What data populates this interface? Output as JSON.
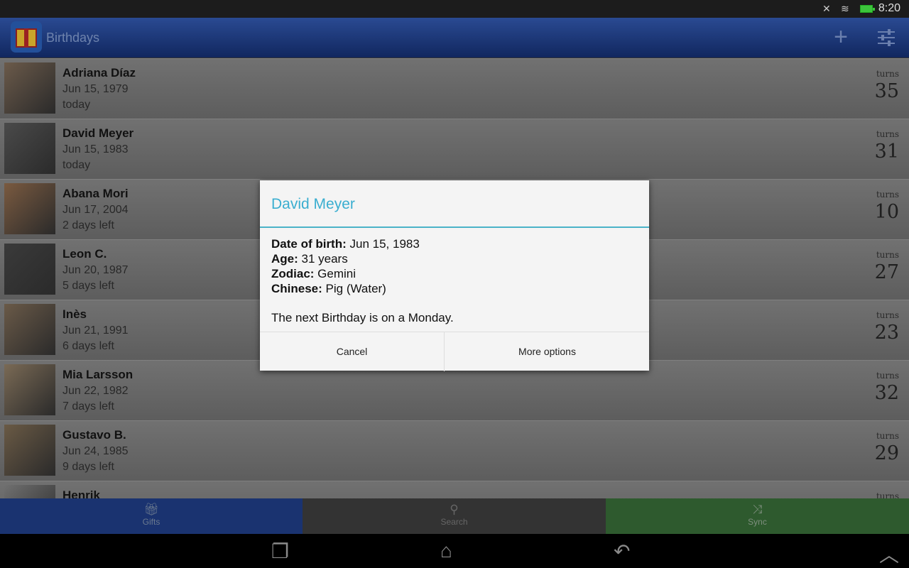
{
  "status_bar": {
    "time": "8:20",
    "icons": [
      "mute-icon",
      "wifi-icon",
      "battery-icon"
    ]
  },
  "app_bar": {
    "title": "Birthdays",
    "actions": [
      "add-icon",
      "settings-sliders-icon"
    ]
  },
  "colors": {
    "app_bar": "#1a3a82",
    "dialog_accent": "#3aaed0",
    "tab_gifts": "#1a3370",
    "tab_search": "#333333",
    "tab_sync": "#2e5a2e"
  },
  "contacts": [
    {
      "name": "Adriana Díaz",
      "dob": "Jun 15, 1979",
      "left": "today",
      "turns_label": "turns",
      "age": "35"
    },
    {
      "name": "David Meyer",
      "dob": "Jun 15, 1983",
      "left": "today",
      "turns_label": "turns",
      "age": "31"
    },
    {
      "name": "Abana Mori",
      "dob": "Jun 17, 2004",
      "left": "2 days left",
      "turns_label": "turns",
      "age": "10"
    },
    {
      "name": "Leon C.",
      "dob": "Jun 20, 1987",
      "left": "5 days left",
      "turns_label": "turns",
      "age": "27"
    },
    {
      "name": "Inès",
      "dob": "Jun 21, 1991",
      "left": "6 days left",
      "turns_label": "turns",
      "age": "23"
    },
    {
      "name": "Mia Larsson",
      "dob": "Jun 22, 1982",
      "left": "7 days left",
      "turns_label": "turns",
      "age": "32"
    },
    {
      "name": "Gustavo B.",
      "dob": "Jun 24, 1985",
      "left": "9 days left",
      "turns_label": "turns",
      "age": "29"
    },
    {
      "name": "Henrik",
      "turns_label": "turns"
    }
  ],
  "tabs": [
    {
      "label": "Gifts",
      "icon": "gift-icon"
    },
    {
      "label": "Search",
      "icon": "search-icon"
    },
    {
      "label": "Sync",
      "icon": "shuffle-icon"
    }
  ],
  "dialog": {
    "title": "David Meyer",
    "fields": [
      {
        "label": "Date of birth:",
        "value": " Jun 15, 1983"
      },
      {
        "label": "Age:",
        "value": " 31 years"
      },
      {
        "label": "Zodiac:",
        "value": " Gemini"
      },
      {
        "label": "Chinese:",
        "value": " Pig (Water)"
      }
    ],
    "next": "The next Birthday is on a Monday.",
    "cancel": "Cancel",
    "more": "More options"
  }
}
